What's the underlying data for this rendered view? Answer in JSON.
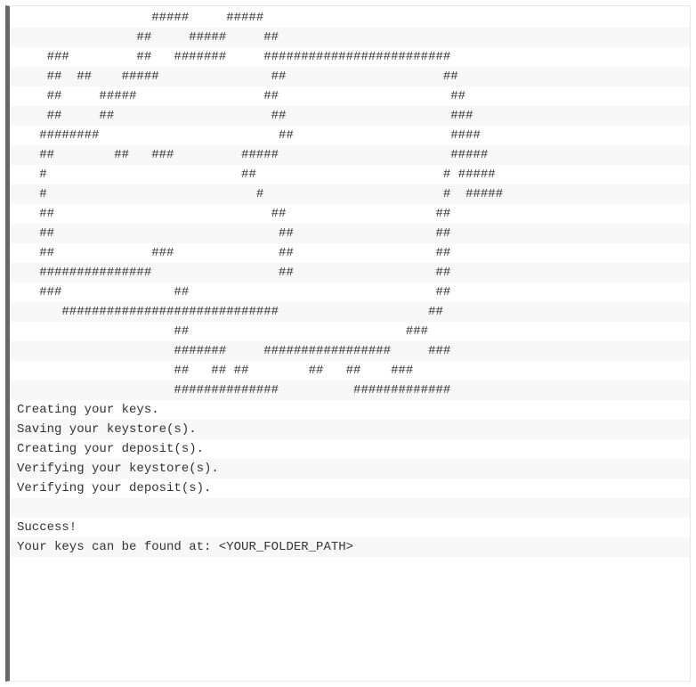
{
  "terminal": {
    "lines": [
      "                  #####     #####",
      "                ##     #####     ##",
      "    ###         ##   #######     #########################",
      "    ##  ##    #####               ##                     ##",
      "    ##     #####                 ##                       ##",
      "    ##     ##                     ##                      ###",
      "   ########                        ##                     ####",
      "   ##        ##   ###         #####                       #####",
      "   #                          ##                         # #####",
      "   #                            #                        #  #####",
      "   ##                             ##                    ##",
      "   ##                              ##                   ##",
      "   ##             ###              ##                   ##",
      "   ###############                 ##                   ##",
      "   ###               ##                                 ##",
      "      #############################                    ##",
      "                     ##                             ###",
      "                     #######     #################     ###",
      "                     ##   ## ##        ##   ##    ###",
      "                     ##############          #############",
      "Creating your keys.",
      "Saving your keystore(s).",
      "Creating your deposit(s).",
      "Verifying your keystore(s).",
      "Verifying your deposit(s).",
      "",
      "Success!",
      "Your keys can be found at: <YOUR_FOLDER_PATH>"
    ]
  }
}
